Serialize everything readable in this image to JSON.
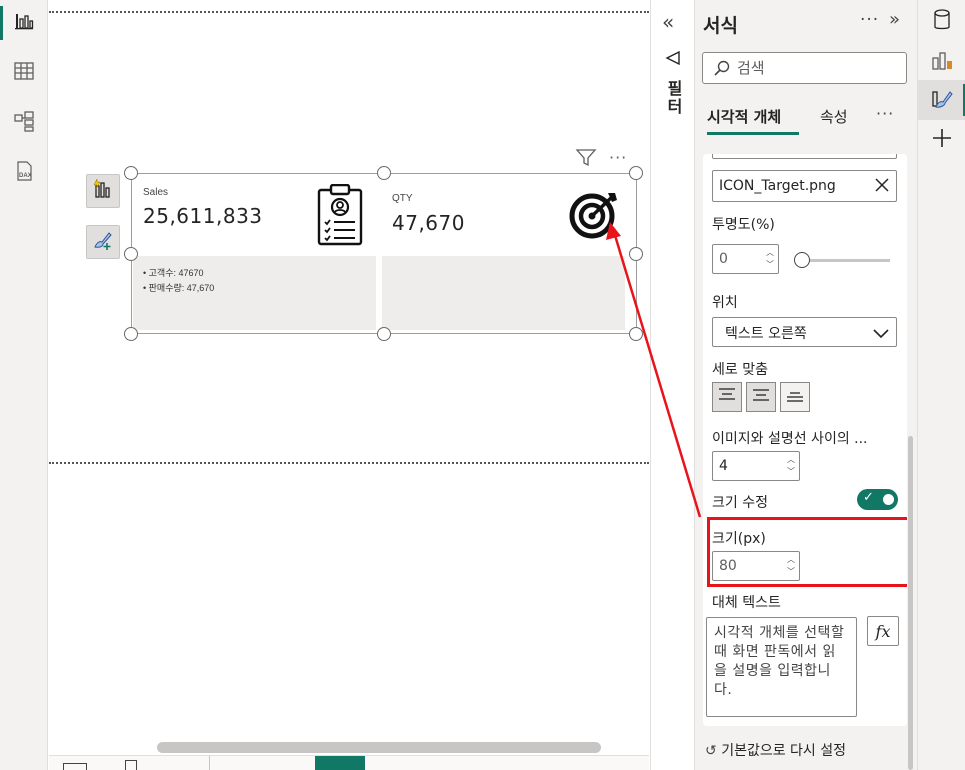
{
  "canvas": {
    "cards": [
      {
        "label": "Sales",
        "value": "25,611,833",
        "icon": "clipboard-person-icon",
        "bullets": [
          "• 고객수: 47670",
          "• 판매수량: 47,670"
        ]
      },
      {
        "label": "QTY",
        "value": "47,670",
        "icon": "target-arrow-icon"
      }
    ]
  },
  "filters": {
    "label": "필터"
  },
  "format_pane": {
    "title": "서식",
    "search_placeholder": "검색",
    "tabs": [
      {
        "label": "시각적 개체",
        "active": true
      },
      {
        "label": "속성",
        "active": false
      }
    ],
    "image_file": "ICON_Target.png",
    "transparency": {
      "label": "투명도(%)",
      "value": "0"
    },
    "position": {
      "label": "위치",
      "selected": "텍스트 오른쪽"
    },
    "vertical_align": {
      "label": "세로 맞춤"
    },
    "spacing": {
      "label": "이미지와 설명선 사이의 ...",
      "value": "4"
    },
    "resize": {
      "label": "크기 수정",
      "on": true
    },
    "size": {
      "label": "크기(px)",
      "value": "80"
    },
    "alt_text": {
      "label": "대체 텍스트",
      "placeholder": "시각적 개체를 선택할 때 화면 판독에서 읽을 설명을 입력합니다."
    },
    "fx_label": "fx",
    "reset": "기본값으로 다시 설정"
  },
  "colors": {
    "accent": "#117865",
    "highlight": "#e8141b",
    "arrow": "#e8141b"
  }
}
